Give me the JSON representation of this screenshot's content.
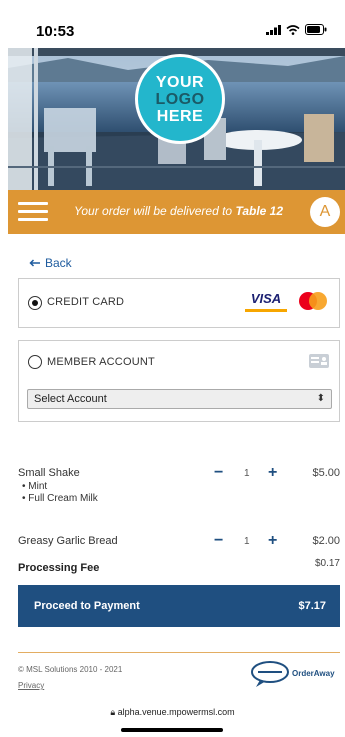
{
  "status": {
    "time": "10:53"
  },
  "logo": {
    "line1": "YOUR",
    "line2": "LOGO",
    "line3": "HERE"
  },
  "order_bar": {
    "text_prefix": "Your order will be delivered to",
    "table": "Table 12",
    "avatar_letter": "A"
  },
  "back": {
    "label": "Back"
  },
  "payment": {
    "credit_card": {
      "label": "CREDIT CARD",
      "selected": true,
      "visa_label": "VISA"
    },
    "member": {
      "label": "MEMBER ACCOUNT",
      "selected": false,
      "select_value": "Select Account"
    }
  },
  "items": [
    {
      "name": "Small Shake",
      "options": [
        "Mint",
        "Full Cream Milk"
      ],
      "qty": "1",
      "price": "$5.00"
    },
    {
      "name": "Greasy Garlic Bread",
      "options": [],
      "qty": "1",
      "price": "$2.00"
    }
  ],
  "fee": {
    "label": "Processing Fee",
    "value": "$0.17"
  },
  "proceed": {
    "label": "Proceed to Payment",
    "total": "$7.17"
  },
  "footer": {
    "copyright": "© MSL Solutions 2010 - 2021",
    "privacy": "Privacy",
    "brand": "OrderAway"
  },
  "browser": {
    "url": "alpha.venue.mpowermsl.com"
  },
  "colors": {
    "accent": "#dd9634",
    "primary": "#1f4f80",
    "logo": "#23b6cc"
  }
}
